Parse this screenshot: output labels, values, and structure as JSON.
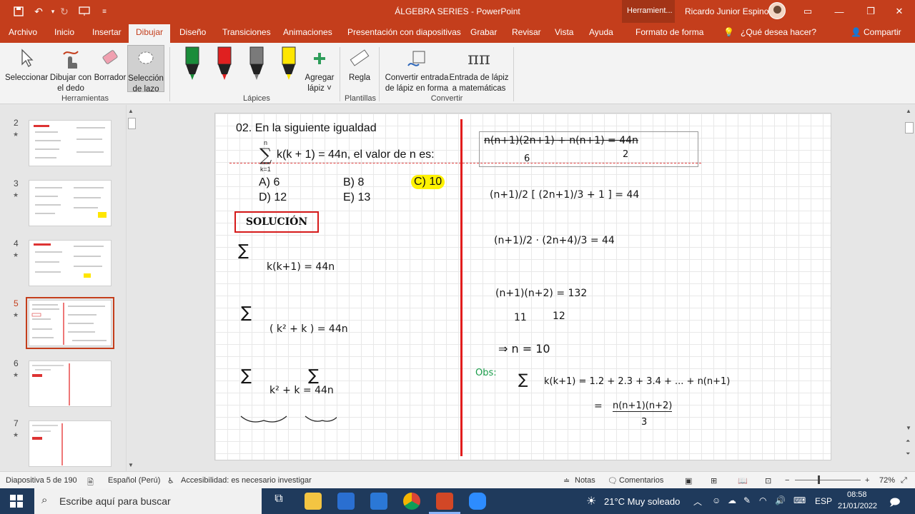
{
  "window": {
    "title": "ÁLGEBRA SERIES  -  PowerPoint",
    "context_tools": "Herramient...",
    "user": "Ricardo Junior Espino"
  },
  "tabs": [
    "Archivo",
    "Inicio",
    "Insertar",
    "Dibujar",
    "Diseño",
    "Transiciones",
    "Animaciones",
    "Presentación con diapositivas",
    "Grabar",
    "Revisar",
    "Vista",
    "Ayuda",
    "Formato de forma"
  ],
  "tell_me": "¿Qué desea hacer?",
  "share": "Compartir",
  "ribbon": {
    "select": "Seleccionar",
    "finger_1": "Dibujar con",
    "finger_2": "el dedo",
    "eraser": "Borrador",
    "lasso_1": "Selección",
    "lasso_2": "de lazo",
    "group_tools": "Herramientas",
    "group_pens": "Lápices",
    "add_pen_1": "Agregar",
    "add_pen_2": "lápiz ˅",
    "ruler": "Regla",
    "group_templates": "Plantillas",
    "ink_shape_1": "Convertir entrada",
    "ink_shape_2": "de lápiz en forma",
    "ink_math_1": "Entrada de lápiz",
    "ink_math_2": "a matemáticas",
    "group_convert": "Convertir",
    "pen_colors": [
      "#1a8c3a",
      "#e02020",
      "#7a7a7a",
      "#ffe600"
    ]
  },
  "thumbnails": [
    {
      "num": "2",
      "star": "★"
    },
    {
      "num": "3",
      "star": "★"
    },
    {
      "num": "4",
      "star": "★"
    },
    {
      "num": "5",
      "star": "★",
      "selected": true
    },
    {
      "num": "6",
      "star": "★"
    },
    {
      "num": "7",
      "star": "★"
    }
  ],
  "slide": {
    "question": "02. En la siguiente igualdad",
    "equation": "k(k + 1) = 44n, el valor de n es:",
    "sum_top": "n",
    "sum_bottom": "k=1",
    "options": {
      "a": "A) 6",
      "b": "B) 8",
      "c": "C) 10",
      "d": "D) 12",
      "e": "E) 13"
    },
    "solution_label": "SOLUCIÓN",
    "left_work": [
      "k(k+1) = 44n",
      "( k² + k )  =  44n",
      "k²  +   k  =  44n"
    ],
    "right_work": {
      "top": "n(n+1)(2n+1)   +   n(n+1)   =   44n",
      "top_den1": "6",
      "top_den2": "2",
      "line1": "(n+1)/2 [ (2n+1)/3 + 1 ] = 44",
      "line2": "(n+1)/2 · (2n+4)/3  =  44",
      "line3": "(n+1)(n+2)  =  132",
      "line3_under1": "11",
      "line3_under2": "12",
      "result": "⇒ n = 10",
      "obs_label": "Obs:",
      "obs_line": "k(k+1)  =  1.2 + 2.3 + 3.4 + ... + n(n+1)",
      "obs_eq": "=",
      "obs_frac": "n(n+1)(n+2)",
      "obs_den": "3"
    }
  },
  "status": {
    "slide_info": "Diapositiva 5 de 190",
    "language": "Español (Perú)",
    "accessibility": "Accesibilidad: es necesario investigar",
    "notes": "Notas",
    "comments": "Comentarios",
    "zoom": "72%"
  },
  "taskbar": {
    "search_placeholder": "Escribe aquí para buscar",
    "weather": "21°C  Muy soleado",
    "lang": "ESP",
    "time": "08:58",
    "date": "21/01/2022"
  }
}
